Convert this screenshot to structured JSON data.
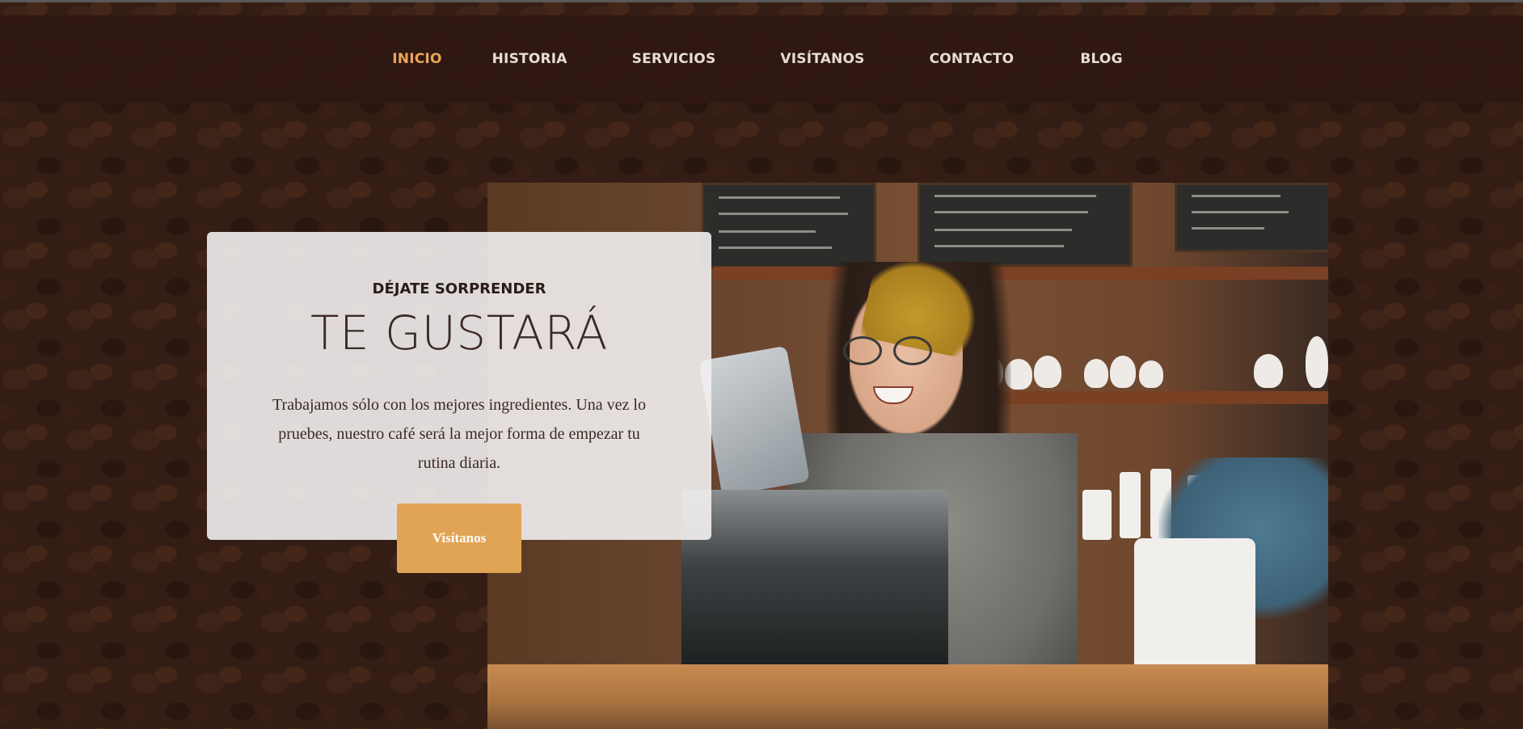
{
  "nav": {
    "items": [
      {
        "label": "INICIO",
        "active": true
      },
      {
        "label": "HISTORIA",
        "active": false
      },
      {
        "label": "SERVICIOS",
        "active": false
      },
      {
        "label": "VISÍTANOS",
        "active": false
      },
      {
        "label": "CONTACTO",
        "active": false
      },
      {
        "label": "BLOG",
        "active": false
      }
    ]
  },
  "hero": {
    "eyebrow": "DÉJATE SORPRENDER",
    "title": "TE GUSTARÁ",
    "description": "Trabajamos sólo con los mejores ingredientes. Una vez lo pruebes, nuestro café será la mejor forma de empezar tu rutina diaria.",
    "cta_label": "Visítanos"
  },
  "colors": {
    "nav_background": "#301812",
    "nav_active": "#e9a65a",
    "nav_text": "#e7dcd6",
    "card_background": "#f2f0f0",
    "cta_background": "#e1a455",
    "background_beans": "#3a2318"
  },
  "images": {
    "background": "coffee-beans-texture",
    "hero_photo": "barista-smiling-behind-counter-photo"
  }
}
